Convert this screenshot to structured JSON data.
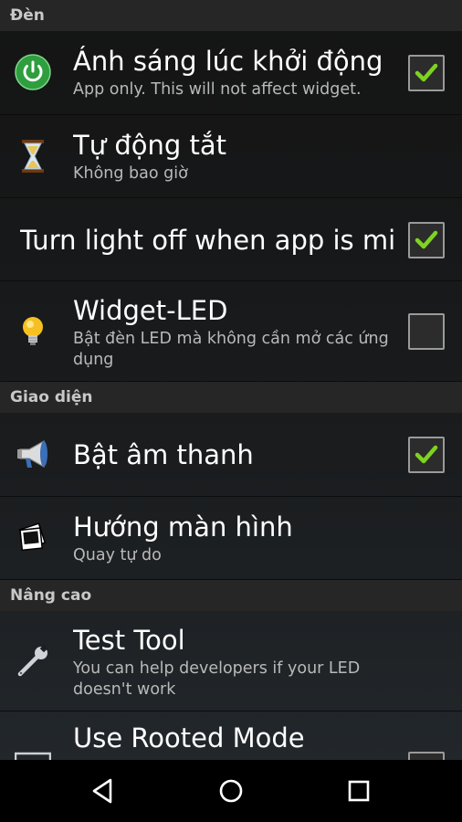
{
  "sections": {
    "light": "Đèn",
    "interface": "Giao diện",
    "advanced": "Nâng cao"
  },
  "items": {
    "startup_light": {
      "title": "Ánh sáng lúc khởi động",
      "summary": "App only. This will not affect widget.",
      "checked": true,
      "icon": "power-icon"
    },
    "auto_off": {
      "title": "Tự động tắt",
      "summary": "Không bao giờ",
      "icon": "hourglass-icon"
    },
    "minimized": {
      "title": "Turn light off when app is mi..",
      "checked": true
    },
    "widget_led": {
      "title": "Widget-LED",
      "summary": "Bật đèn LED mà không cần mở các ứng dụng",
      "checked": false,
      "icon": "lightbulb-icon"
    },
    "sound": {
      "title": "Bật âm thanh",
      "checked": true,
      "icon": "megaphone-icon"
    },
    "orientation": {
      "title": "Hướng màn hình",
      "summary": "Quay tự do",
      "icon": "photos-icon"
    },
    "test_tool": {
      "title": "Test Tool",
      "summary": "You can help developers if your LED doesn't work",
      "icon": "wrench-icon"
    },
    "rooted": {
      "title": "Use Rooted Mode",
      "checked": false
    }
  },
  "colors": {
    "check": "#7ed321",
    "power": "#2e9e3e"
  },
  "nav": {
    "back": "back-icon",
    "home": "home-icon",
    "recents": "recents-icon"
  }
}
